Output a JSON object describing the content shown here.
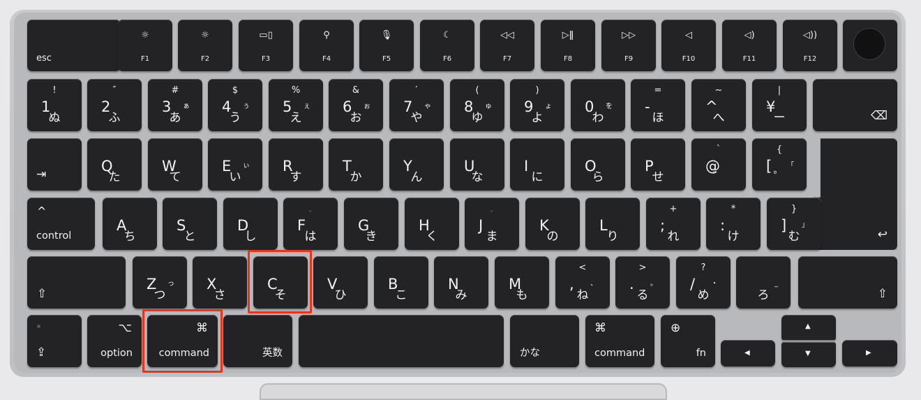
{
  "keyboard": {
    "row_fn": {
      "esc": "esc",
      "f1": {
        "label": "F1",
        "icon": "brightness-down-icon",
        "glyph": "☼"
      },
      "f2": {
        "label": "F2",
        "icon": "brightness-up-icon",
        "glyph": "☼"
      },
      "f3": {
        "label": "F3",
        "icon": "mission-control-icon",
        "glyph": "▭▯"
      },
      "f4": {
        "label": "F4",
        "icon": "search-icon",
        "glyph": "⚲"
      },
      "f5": {
        "label": "F5",
        "icon": "microphone-icon",
        "glyph": "🎙"
      },
      "f6": {
        "label": "F6",
        "icon": "moon-icon",
        "glyph": "☾"
      },
      "f7": {
        "label": "F7",
        "icon": "rewind-icon",
        "glyph": "◁◁"
      },
      "f8": {
        "label": "F8",
        "icon": "play-pause-icon",
        "glyph": "▷ǁ"
      },
      "f9": {
        "label": "F9",
        "icon": "fast-forward-icon",
        "glyph": "▷▷"
      },
      "f10": {
        "label": "F10",
        "icon": "mute-icon",
        "glyph": "◁"
      },
      "f11": {
        "label": "F11",
        "icon": "volume-down-icon",
        "glyph": "◁)"
      },
      "f12": {
        "label": "F12",
        "icon": "volume-up-icon",
        "glyph": "◁))"
      },
      "power": {
        "icon": "touch-id-icon"
      }
    },
    "row_num": [
      {
        "sym": "!",
        "main": "1",
        "kana": "ぬ",
        "kana_small": ""
      },
      {
        "sym": "″",
        "main": "2",
        "kana": "ふ",
        "kana_small": ""
      },
      {
        "sym": "#",
        "main": "3",
        "kana": "あ",
        "kana_small": "ぁ"
      },
      {
        "sym": "$",
        "main": "4",
        "kana": "う",
        "kana_small": "ぅ"
      },
      {
        "sym": "%",
        "main": "5",
        "kana": "え",
        "kana_small": "ぇ"
      },
      {
        "sym": "&",
        "main": "6",
        "kana": "お",
        "kana_small": "ぉ"
      },
      {
        "sym": "′",
        "main": "7",
        "kana": "や",
        "kana_small": "ゃ"
      },
      {
        "sym": "(",
        "main": "8",
        "kana": "ゆ",
        "kana_small": "ゅ"
      },
      {
        "sym": ")",
        "main": "9",
        "kana": "よ",
        "kana_small": "ょ"
      },
      {
        "sym": "",
        "main": "0",
        "kana": "わ",
        "kana_small": "を"
      },
      {
        "sym": "=",
        "main": "-",
        "kana": "ほ",
        "kana_small": ""
      },
      {
        "sym": "~",
        "main": "^",
        "kana": "へ",
        "kana_small": ""
      },
      {
        "sym": "|",
        "main": "¥",
        "kana": "ー",
        "kana_small": ""
      }
    ],
    "delete": {
      "icon": "delete-icon",
      "glyph": "⌫"
    },
    "row_q": [
      {
        "main": "Q",
        "kana": "た",
        "kana_small": ""
      },
      {
        "main": "W",
        "kana": "て",
        "kana_small": ""
      },
      {
        "main": "E",
        "kana": "い",
        "kana_small": "ぃ"
      },
      {
        "main": "R",
        "kana": "す",
        "kana_small": ""
      },
      {
        "main": "T",
        "kana": "か",
        "kana_small": ""
      },
      {
        "main": "Y",
        "kana": "ん",
        "kana_small": ""
      },
      {
        "main": "U",
        "kana": "な",
        "kana_small": ""
      },
      {
        "main": "I",
        "kana": "に",
        "kana_small": ""
      },
      {
        "main": "O",
        "kana": "ら",
        "kana_small": ""
      },
      {
        "main": "P",
        "kana": "せ",
        "kana_small": ""
      },
      {
        "sym": "`",
        "main": "@",
        "kana": "゛",
        "kana_small": ""
      },
      {
        "sym": "{",
        "main": "[",
        "kana": "゜",
        "kana_small": "「"
      }
    ],
    "tab": {
      "icon": "tab-icon",
      "glyph": "⇥"
    },
    "control": {
      "label": "control",
      "glyph": "^"
    },
    "row_a": [
      {
        "main": "A",
        "kana": "ち"
      },
      {
        "main": "S",
        "kana": "と"
      },
      {
        "main": "D",
        "kana": "し"
      },
      {
        "main": "F",
        "kana": "は"
      },
      {
        "main": "G",
        "kana": "き"
      },
      {
        "main": "H",
        "kana": "く"
      },
      {
        "main": "J",
        "kana": "ま"
      },
      {
        "main": "K",
        "kana": "の"
      },
      {
        "main": "L",
        "kana": "り"
      },
      {
        "sym": "+",
        "main": ";",
        "kana": "れ"
      },
      {
        "sym": "*",
        "main": ":",
        "kana": "け"
      },
      {
        "sym": "}",
        "main": "]",
        "kana": "む",
        "kana_small": "」"
      }
    ],
    "return": {
      "icon": "return-icon",
      "glyph": "↩"
    },
    "shift_left": {
      "icon": "shift-icon",
      "glyph": "⇧"
    },
    "row_z": [
      {
        "main": "Z",
        "kana": "つ",
        "kana_small": "っ"
      },
      {
        "main": "X",
        "kana": "さ"
      },
      {
        "main": "C",
        "kana": "そ"
      },
      {
        "main": "V",
        "kana": "ひ"
      },
      {
        "main": "B",
        "kana": "こ"
      },
      {
        "main": "N",
        "kana": "み"
      },
      {
        "main": "M",
        "kana": "も"
      },
      {
        "sym": "<",
        "main": ",",
        "kana": "ね",
        "kana_small": "、"
      },
      {
        "sym": ">",
        "main": ".",
        "kana": "る",
        "kana_small": "。"
      },
      {
        "sym": "?",
        "main": "/",
        "kana": "め",
        "kana_small": "・"
      },
      {
        "sym": "",
        "main": "",
        "kana": "ろ",
        "kana_small": "_"
      }
    ],
    "shift_right": {
      "icon": "shift-icon",
      "glyph": "⇧"
    },
    "caps": {
      "icon": "caps-lock-icon",
      "glyph": "⇪"
    },
    "option": {
      "label": "option",
      "glyph": "⌥"
    },
    "command_left": {
      "label": "command",
      "glyph": "⌘"
    },
    "eisu": {
      "label": "英数"
    },
    "kana": {
      "label": "かな"
    },
    "command_right": {
      "label": "command",
      "glyph": "⌘"
    },
    "fn": {
      "label": "fn",
      "icon": "globe-icon",
      "glyph": "⊕"
    },
    "arrows": {
      "up": "▲",
      "down": "▼",
      "left": "◀",
      "right": "▶"
    }
  },
  "highlight_color": "#e8341c"
}
